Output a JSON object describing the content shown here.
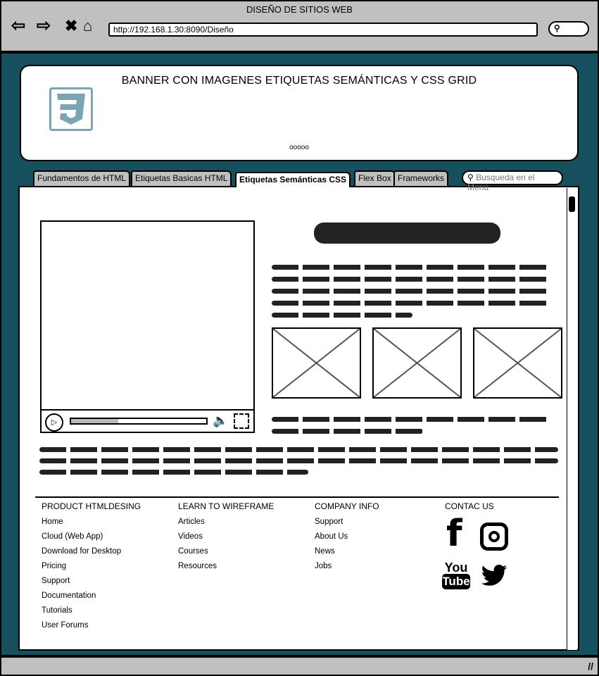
{
  "browser": {
    "title": "DISEÑO DE SITIOS WEB",
    "url": "http://192.168.1.30:8090/Diseño"
  },
  "banner": {
    "title": "BANNER  CON IMAGENES ETIQUETAS SEMÁNTICAS Y CSS GRID",
    "pager": "ooooo"
  },
  "tabs": [
    {
      "label": "Fundamentos de HTML"
    },
    {
      "label": "Etiquetas Basicas HTML"
    },
    {
      "label": "Etiquetas Semánticas CSS"
    },
    {
      "label": "Flex Box"
    },
    {
      "label": "Frameworks"
    }
  ],
  "menu_search": {
    "placeholder": "Busqueda en el Menú"
  },
  "video": {
    "progress": 0.35
  },
  "footer": {
    "col1": {
      "title": "PRODUCT HTMLDESING",
      "links": [
        "Home",
        "Cloud (Web App)",
        "Download for Desktop",
        "Pricing",
        "Support",
        "Documentation",
        "Tutorials",
        "User Forums"
      ]
    },
    "col2": {
      "title": "LEARN TO WIREFRAME",
      "links": [
        "Articles",
        "Videos",
        "Courses",
        "Resources"
      ]
    },
    "col3": {
      "title": "COMPANY INFO",
      "links": [
        "Support",
        "About Us",
        "News",
        "Jobs"
      ]
    },
    "col4": {
      "title": "CONTAC US",
      "youtube_you": "You",
      "youtube_tube": "Tube"
    }
  }
}
